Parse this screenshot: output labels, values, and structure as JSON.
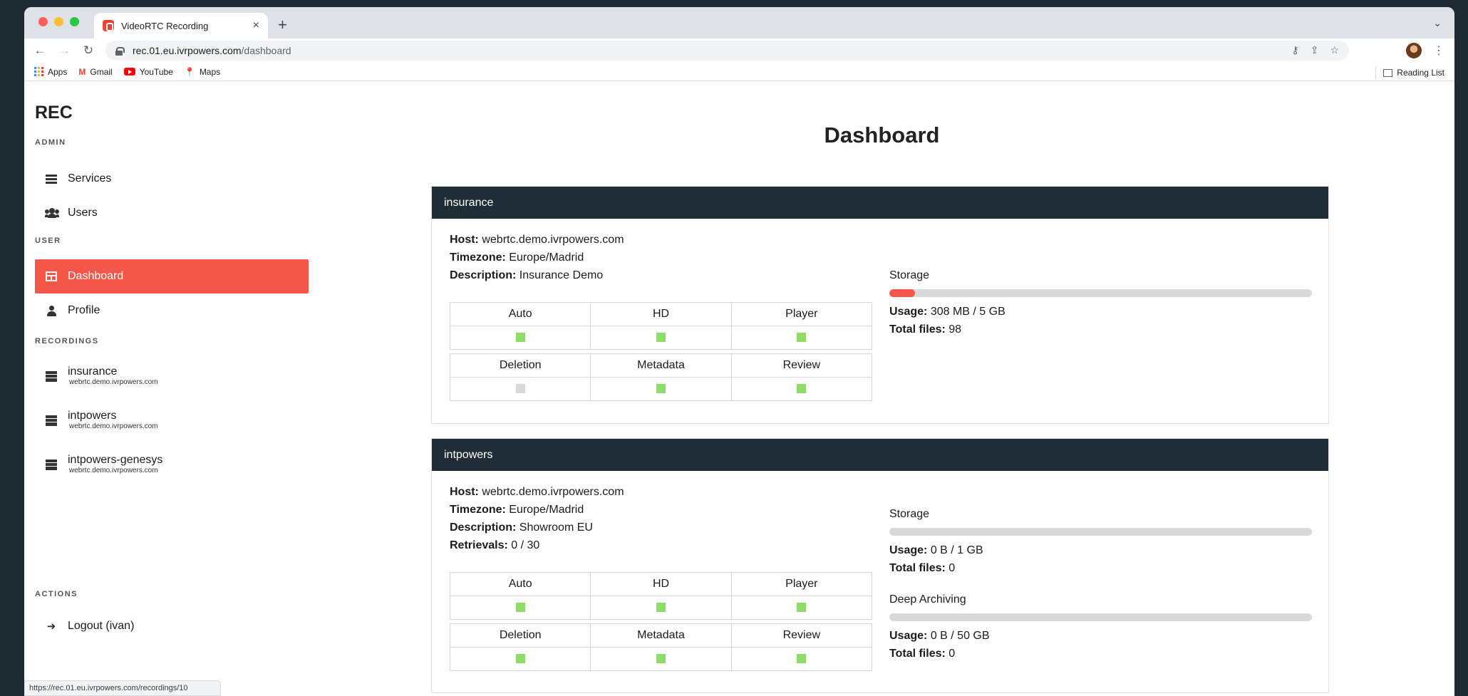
{
  "browser": {
    "tab_title": "VideoRTC Recording",
    "url_host": "rec.01.eu.ivrpowers.com",
    "url_path": "/dashboard",
    "bookmarks": [
      "Apps",
      "Gmail",
      "YouTube",
      "Maps"
    ],
    "reading_list": "Reading List",
    "status_url": "https://rec.01.eu.ivrpowers.com/recordings/10"
  },
  "sidebar": {
    "brand": "REC",
    "sections": {
      "admin": "ADMIN",
      "user": "USER",
      "recordings": "RECORDINGS",
      "actions": "ACTIONS"
    },
    "admin_items": [
      {
        "label": "Services",
        "icon": "list-icon"
      },
      {
        "label": "Users",
        "icon": "users-icon"
      }
    ],
    "user_items": [
      {
        "label": "Dashboard",
        "icon": "table-icon",
        "active": true
      },
      {
        "label": "Profile",
        "icon": "user-icon"
      }
    ],
    "recordings": [
      {
        "name": "insurance",
        "host": "webrtc.demo.ivrpowers.com"
      },
      {
        "name": "intpowers",
        "host": "webrtc.demo.ivrpowers.com"
      },
      {
        "name": "intpowers-genesys",
        "host": "webrtc.demo.ivrpowers.com"
      }
    ],
    "logout": "Logout (ivan)"
  },
  "main": {
    "title": "Dashboard",
    "labels": {
      "host": "Host:",
      "timezone": "Timezone:",
      "description": "Description:",
      "retrievals": "Retrievals:",
      "usage": "Usage:",
      "total_files": "Total files:",
      "storage": "Storage",
      "deep_archiving": "Deep Archiving"
    },
    "flag_names": [
      "Auto",
      "HD",
      "Player",
      "Deletion",
      "Metadata",
      "Review"
    ],
    "services": [
      {
        "name": "insurance",
        "host": "webrtc.demo.ivrpowers.com",
        "timezone": "Europe/Madrid",
        "description": "Insurance Demo",
        "flags": [
          true,
          true,
          true,
          false,
          true,
          true
        ],
        "storage_usage": "308 MB / 5 GB",
        "storage_fraction": 0.06,
        "total_files": "98"
      },
      {
        "name": "intpowers",
        "host": "webrtc.demo.ivrpowers.com",
        "timezone": "Europe/Madrid",
        "description": "Showroom EU",
        "retrievals": "0 / 30",
        "flags": [
          true,
          true,
          true,
          true,
          true,
          true
        ],
        "storage_usage": "0 B / 1 GB",
        "storage_fraction": 0,
        "total_files": "0",
        "deep_usage": "0 B / 50 GB",
        "deep_fraction": 0,
        "deep_total_files": "0"
      }
    ]
  },
  "colors": {
    "accent": "#f4574a",
    "header_dark": "#1f2e36",
    "flag_on": "#8fdc6a",
    "flag_off": "#d9d9d9"
  }
}
